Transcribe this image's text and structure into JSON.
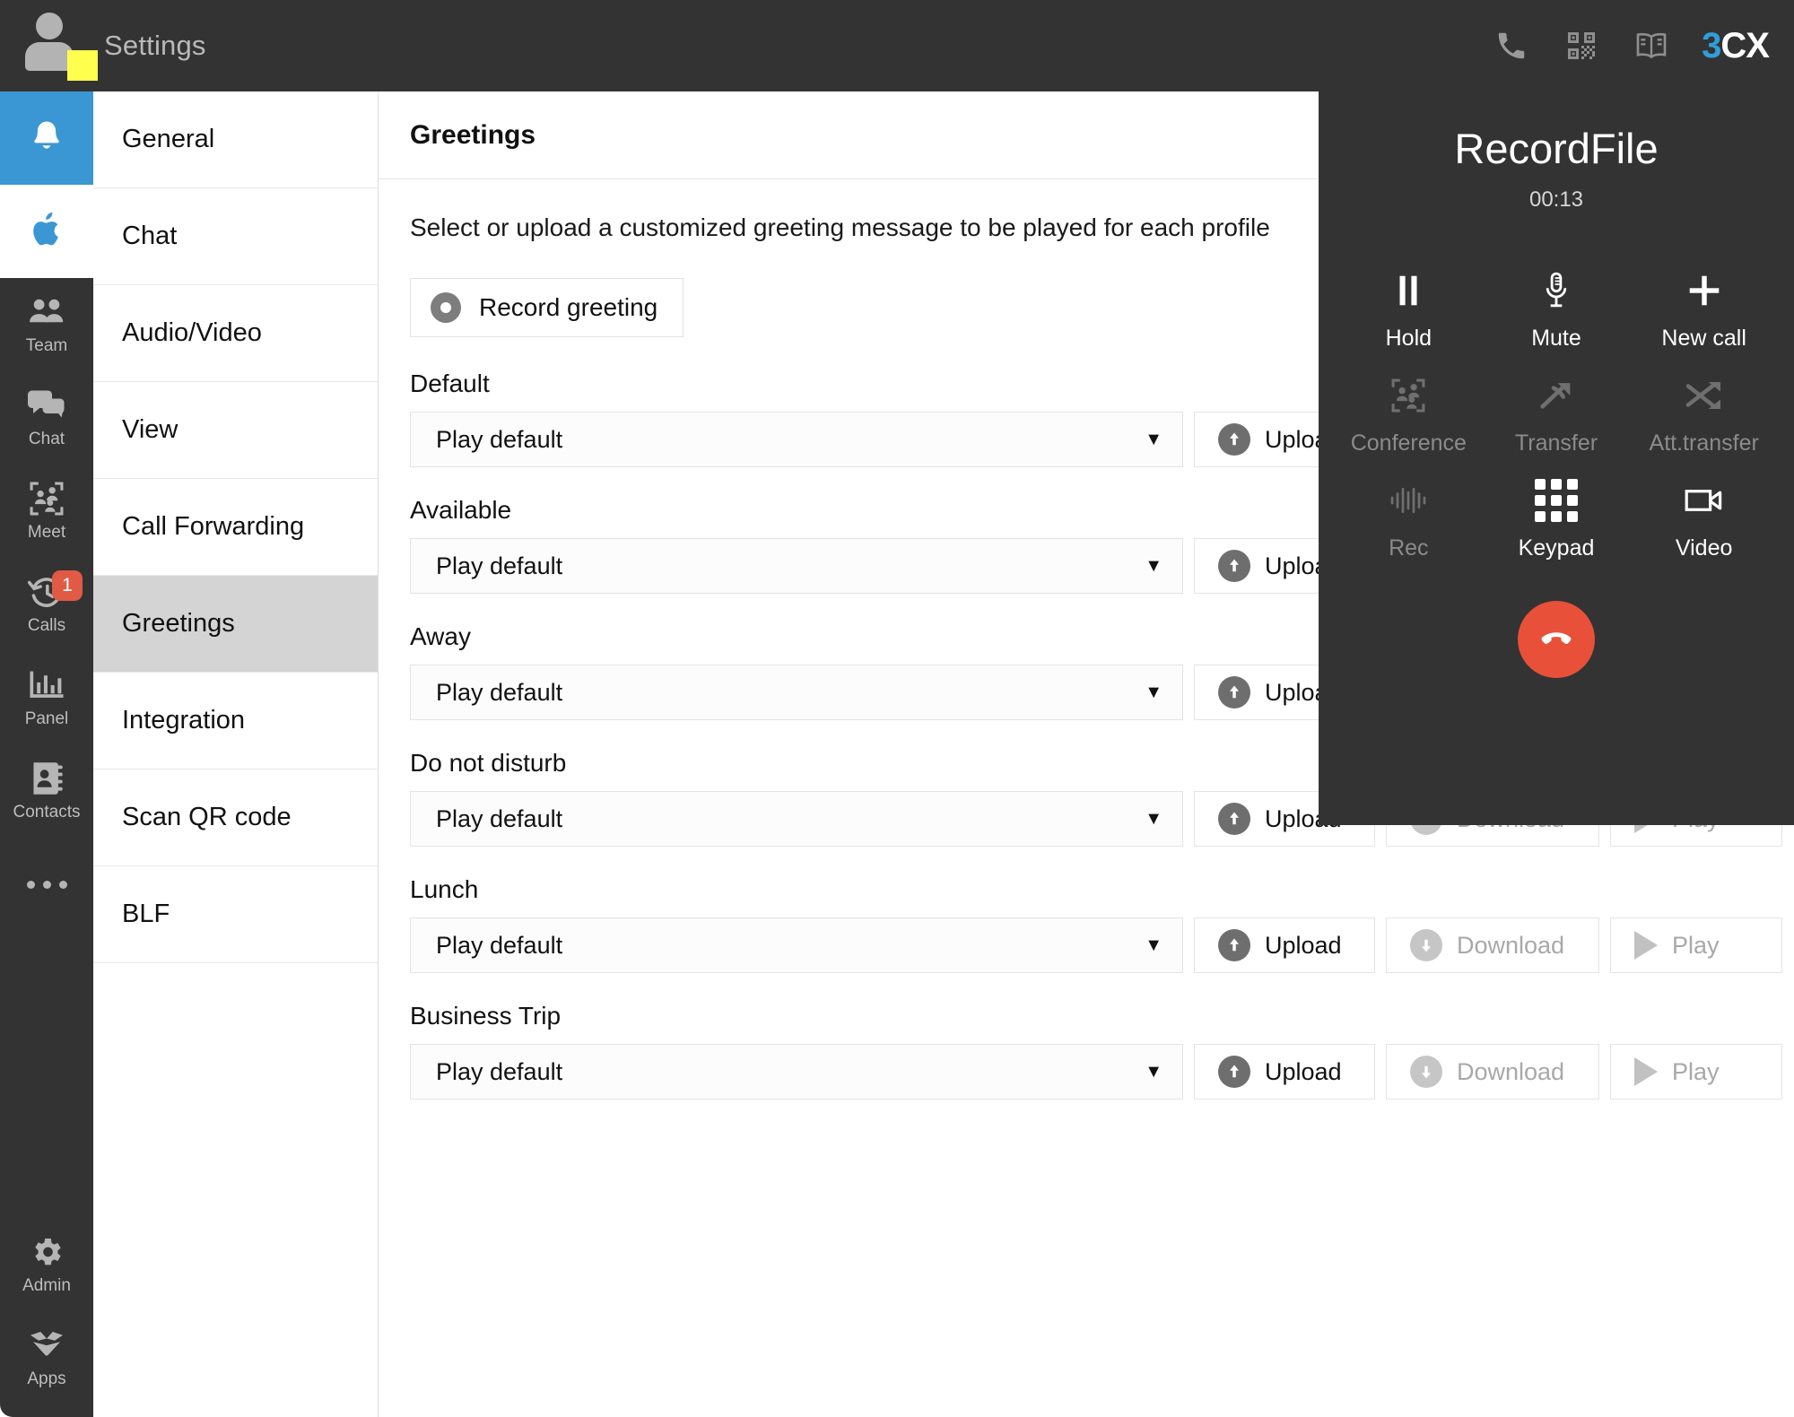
{
  "topbar": {
    "title": "Settings",
    "icons": [
      {
        "name": "phone-icon"
      },
      {
        "name": "qr-code-icon"
      },
      {
        "name": "manual-book-icon"
      }
    ],
    "logo": {
      "part1": "3",
      "part2": "CX"
    }
  },
  "rail": {
    "notification_tile": {
      "icon": "bell-icon"
    },
    "platform_tile": {
      "icon": "apple-icon"
    },
    "items": [
      {
        "label": "Team",
        "icon": "team-icon",
        "badge": null
      },
      {
        "label": "Chat",
        "icon": "chat-icon",
        "badge": null
      },
      {
        "label": "Meet",
        "icon": "meet-icon",
        "badge": null
      },
      {
        "label": "Calls",
        "icon": "calls-history-icon",
        "badge": "1"
      },
      {
        "label": "Panel",
        "icon": "panel-chart-icon",
        "badge": null
      },
      {
        "label": "Contacts",
        "icon": "contacts-book-icon",
        "badge": null
      }
    ],
    "more": {
      "icon": "more-dots-icon"
    },
    "bottom_items": [
      {
        "label": "Admin",
        "icon": "gear-icon"
      },
      {
        "label": "Apps",
        "icon": "apps-box-icon"
      }
    ]
  },
  "settings_menu": {
    "items": [
      {
        "label": "General",
        "selected": false
      },
      {
        "label": "Chat",
        "selected": false
      },
      {
        "label": "Audio/Video",
        "selected": false
      },
      {
        "label": "View",
        "selected": false
      },
      {
        "label": "Call Forwarding",
        "selected": false
      },
      {
        "label": "Greetings",
        "selected": true
      },
      {
        "label": "Integration",
        "selected": false
      },
      {
        "label": "Scan QR code",
        "selected": false
      },
      {
        "label": "BLF",
        "selected": false
      }
    ]
  },
  "content": {
    "header": "Greetings",
    "description": "Select or upload a customized greeting message to be played for each profile",
    "record_button": {
      "label": "Record greeting",
      "icon": "record-circle-icon"
    },
    "actions": {
      "upload_label": "Upload",
      "download_label": "Download",
      "play_label": "Play"
    },
    "greetings": [
      {
        "label": "Default",
        "value": "Play default"
      },
      {
        "label": "Available",
        "value": "Play default"
      },
      {
        "label": "Away",
        "value": "Play default"
      },
      {
        "label": "Do not disturb",
        "value": "Play default"
      },
      {
        "label": "Lunch",
        "value": "Play default"
      },
      {
        "label": "Business Trip",
        "value": "Play default"
      }
    ]
  },
  "call_panel": {
    "title": "RecordFile",
    "timer": "00:13",
    "controls": [
      {
        "label": "Hold",
        "icon": "pause-icon",
        "enabled": true
      },
      {
        "label": "Mute",
        "icon": "microphone-icon",
        "enabled": true
      },
      {
        "label": "New call",
        "icon": "plus-icon",
        "enabled": true
      },
      {
        "label": "Conference",
        "icon": "conference-icon",
        "enabled": false
      },
      {
        "label": "Transfer",
        "icon": "transfer-arrow-icon",
        "enabled": false
      },
      {
        "label": "Att.transfer",
        "icon": "attended-transfer-icon",
        "enabled": false
      },
      {
        "label": "Rec",
        "icon": "waveform-icon",
        "enabled": false
      },
      {
        "label": "Keypad",
        "icon": "keypad-icon",
        "enabled": true
      },
      {
        "label": "Video",
        "icon": "video-camera-icon",
        "enabled": true
      }
    ],
    "hangup": {
      "icon": "hangup-phone-icon"
    }
  },
  "colors": {
    "dark_chrome": "#333333",
    "accent_blue": "#3b97d3",
    "status_yellow": "#ffff4d",
    "badge_red": "#e05a45",
    "hangup_red": "#e8503a"
  }
}
